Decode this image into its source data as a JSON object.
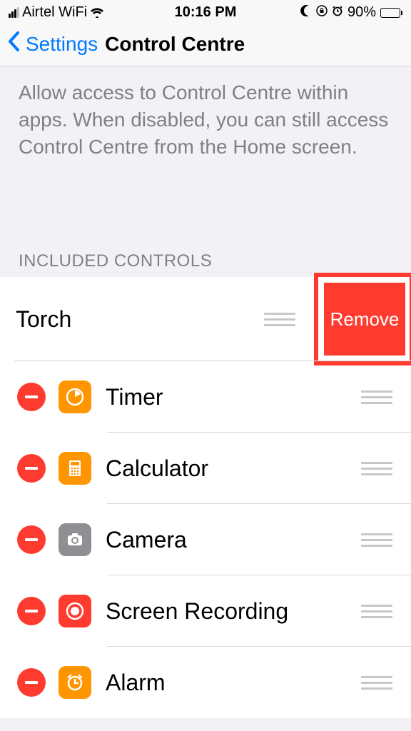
{
  "status": {
    "carrier": "Airtel WiFi",
    "time": "10:16 PM",
    "battery_pct": "90%"
  },
  "nav": {
    "back_label": "Settings",
    "title": "Control Centre"
  },
  "description": "Allow access to Control Centre within apps. When disabled, you can still access Control Centre from the Home screen.",
  "section_header": "INCLUDED CONTROLS",
  "remove_label": "Remove",
  "controls": [
    {
      "label": "Torch",
      "icon": "torch",
      "icon_bg": "none",
      "shifted": true
    },
    {
      "label": "Timer",
      "icon": "timer",
      "icon_bg": "orange"
    },
    {
      "label": "Calculator",
      "icon": "calculator",
      "icon_bg": "orange"
    },
    {
      "label": "Camera",
      "icon": "camera",
      "icon_bg": "gray"
    },
    {
      "label": "Screen Recording",
      "icon": "record",
      "icon_bg": "red"
    },
    {
      "label": "Alarm",
      "icon": "alarm",
      "icon_bg": "orange"
    }
  ]
}
